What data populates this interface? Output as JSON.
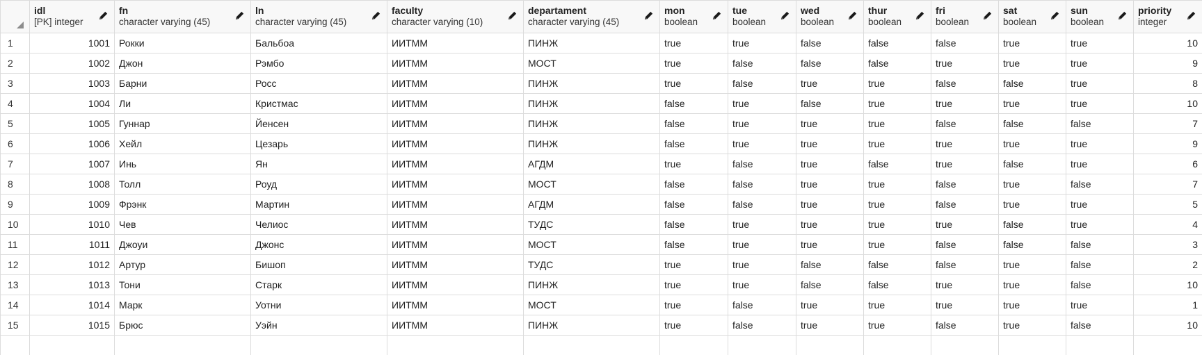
{
  "columns": [
    {
      "name": "idl",
      "type": "[PK] integer",
      "align": "right"
    },
    {
      "name": "fn",
      "type": "character varying (45)",
      "align": "left"
    },
    {
      "name": "ln",
      "type": "character varying (45)",
      "align": "left"
    },
    {
      "name": "faculty",
      "type": "character varying (10)",
      "align": "left"
    },
    {
      "name": "departament",
      "type": "character varying (45)",
      "align": "left"
    },
    {
      "name": "mon",
      "type": "boolean",
      "align": "left"
    },
    {
      "name": "tue",
      "type": "boolean",
      "align": "left"
    },
    {
      "name": "wed",
      "type": "boolean",
      "align": "left"
    },
    {
      "name": "thur",
      "type": "boolean",
      "align": "left"
    },
    {
      "name": "fri",
      "type": "boolean",
      "align": "left"
    },
    {
      "name": "sat",
      "type": "boolean",
      "align": "left"
    },
    {
      "name": "sun",
      "type": "boolean",
      "align": "left"
    },
    {
      "name": "priority",
      "type": "integer",
      "align": "right"
    }
  ],
  "rows": [
    {
      "n": "1",
      "cells": [
        "1001",
        "Рокки",
        "Бальбоа",
        "ИИТММ",
        "ПИНЖ",
        "true",
        "true",
        "false",
        "false",
        "false",
        "true",
        "true",
        "10"
      ]
    },
    {
      "n": "2",
      "cells": [
        "1002",
        "Джон",
        "Рэмбо",
        "ИИТММ",
        "МОСТ",
        "true",
        "false",
        "false",
        "false",
        "true",
        "true",
        "true",
        "9"
      ]
    },
    {
      "n": "3",
      "cells": [
        "1003",
        "Барни",
        "Росс",
        "ИИТММ",
        "ПИНЖ",
        "true",
        "false",
        "true",
        "true",
        "false",
        "false",
        "true",
        "8"
      ]
    },
    {
      "n": "4",
      "cells": [
        "1004",
        "Ли",
        "Кристмас",
        "ИИТММ",
        "ПИНЖ",
        "false",
        "true",
        "false",
        "true",
        "true",
        "true",
        "true",
        "10"
      ]
    },
    {
      "n": "5",
      "cells": [
        "1005",
        "Гуннар",
        "Йенсен",
        "ИИТММ",
        "ПИНЖ",
        "false",
        "true",
        "true",
        "true",
        "false",
        "false",
        "false",
        "7"
      ]
    },
    {
      "n": "6",
      "cells": [
        "1006",
        "Хейл",
        "Цезарь",
        "ИИТММ",
        "ПИНЖ",
        "false",
        "true",
        "true",
        "true",
        "true",
        "true",
        "true",
        "9"
      ]
    },
    {
      "n": "7",
      "cells": [
        "1007",
        "Инь",
        "Ян",
        "ИИТММ",
        "АГДМ",
        "true",
        "false",
        "true",
        "false",
        "true",
        "false",
        "true",
        "6"
      ]
    },
    {
      "n": "8",
      "cells": [
        "1008",
        "Толл",
        "Роуд",
        "ИИТММ",
        "МОСТ",
        "false",
        "false",
        "true",
        "true",
        "false",
        "true",
        "false",
        "7"
      ]
    },
    {
      "n": "9",
      "cells": [
        "1009",
        "Фрэнк",
        "Мартин",
        "ИИТММ",
        "АГДМ",
        "false",
        "false",
        "true",
        "true",
        "false",
        "true",
        "true",
        "5"
      ]
    },
    {
      "n": "10",
      "cells": [
        "1010",
        "Чев",
        "Челиос",
        "ИИТММ",
        "ТУДС",
        "false",
        "true",
        "true",
        "true",
        "true",
        "false",
        "true",
        "4"
      ]
    },
    {
      "n": "11",
      "cells": [
        "1011",
        "Джоуи",
        "Джонс",
        "ИИТММ",
        "МОСТ",
        "false",
        "true",
        "true",
        "true",
        "false",
        "false",
        "false",
        "3"
      ]
    },
    {
      "n": "12",
      "cells": [
        "1012",
        "Артур",
        "Бишоп",
        "ИИТММ",
        "ТУДС",
        "true",
        "true",
        "false",
        "false",
        "false",
        "true",
        "false",
        "2"
      ]
    },
    {
      "n": "13",
      "cells": [
        "1013",
        "Тони",
        "Старк",
        "ИИТММ",
        "ПИНЖ",
        "true",
        "true",
        "false",
        "false",
        "true",
        "true",
        "false",
        "10"
      ]
    },
    {
      "n": "14",
      "cells": [
        "1014",
        "Марк",
        "Уотни",
        "ИИТММ",
        "МОСТ",
        "true",
        "false",
        "true",
        "true",
        "true",
        "true",
        "true",
        "1"
      ]
    },
    {
      "n": "15",
      "cells": [
        "1015",
        "Брюс",
        "Уэйн",
        "ИИТММ",
        "ПИНЖ",
        "true",
        "false",
        "true",
        "true",
        "false",
        "true",
        "false",
        "10"
      ]
    }
  ]
}
